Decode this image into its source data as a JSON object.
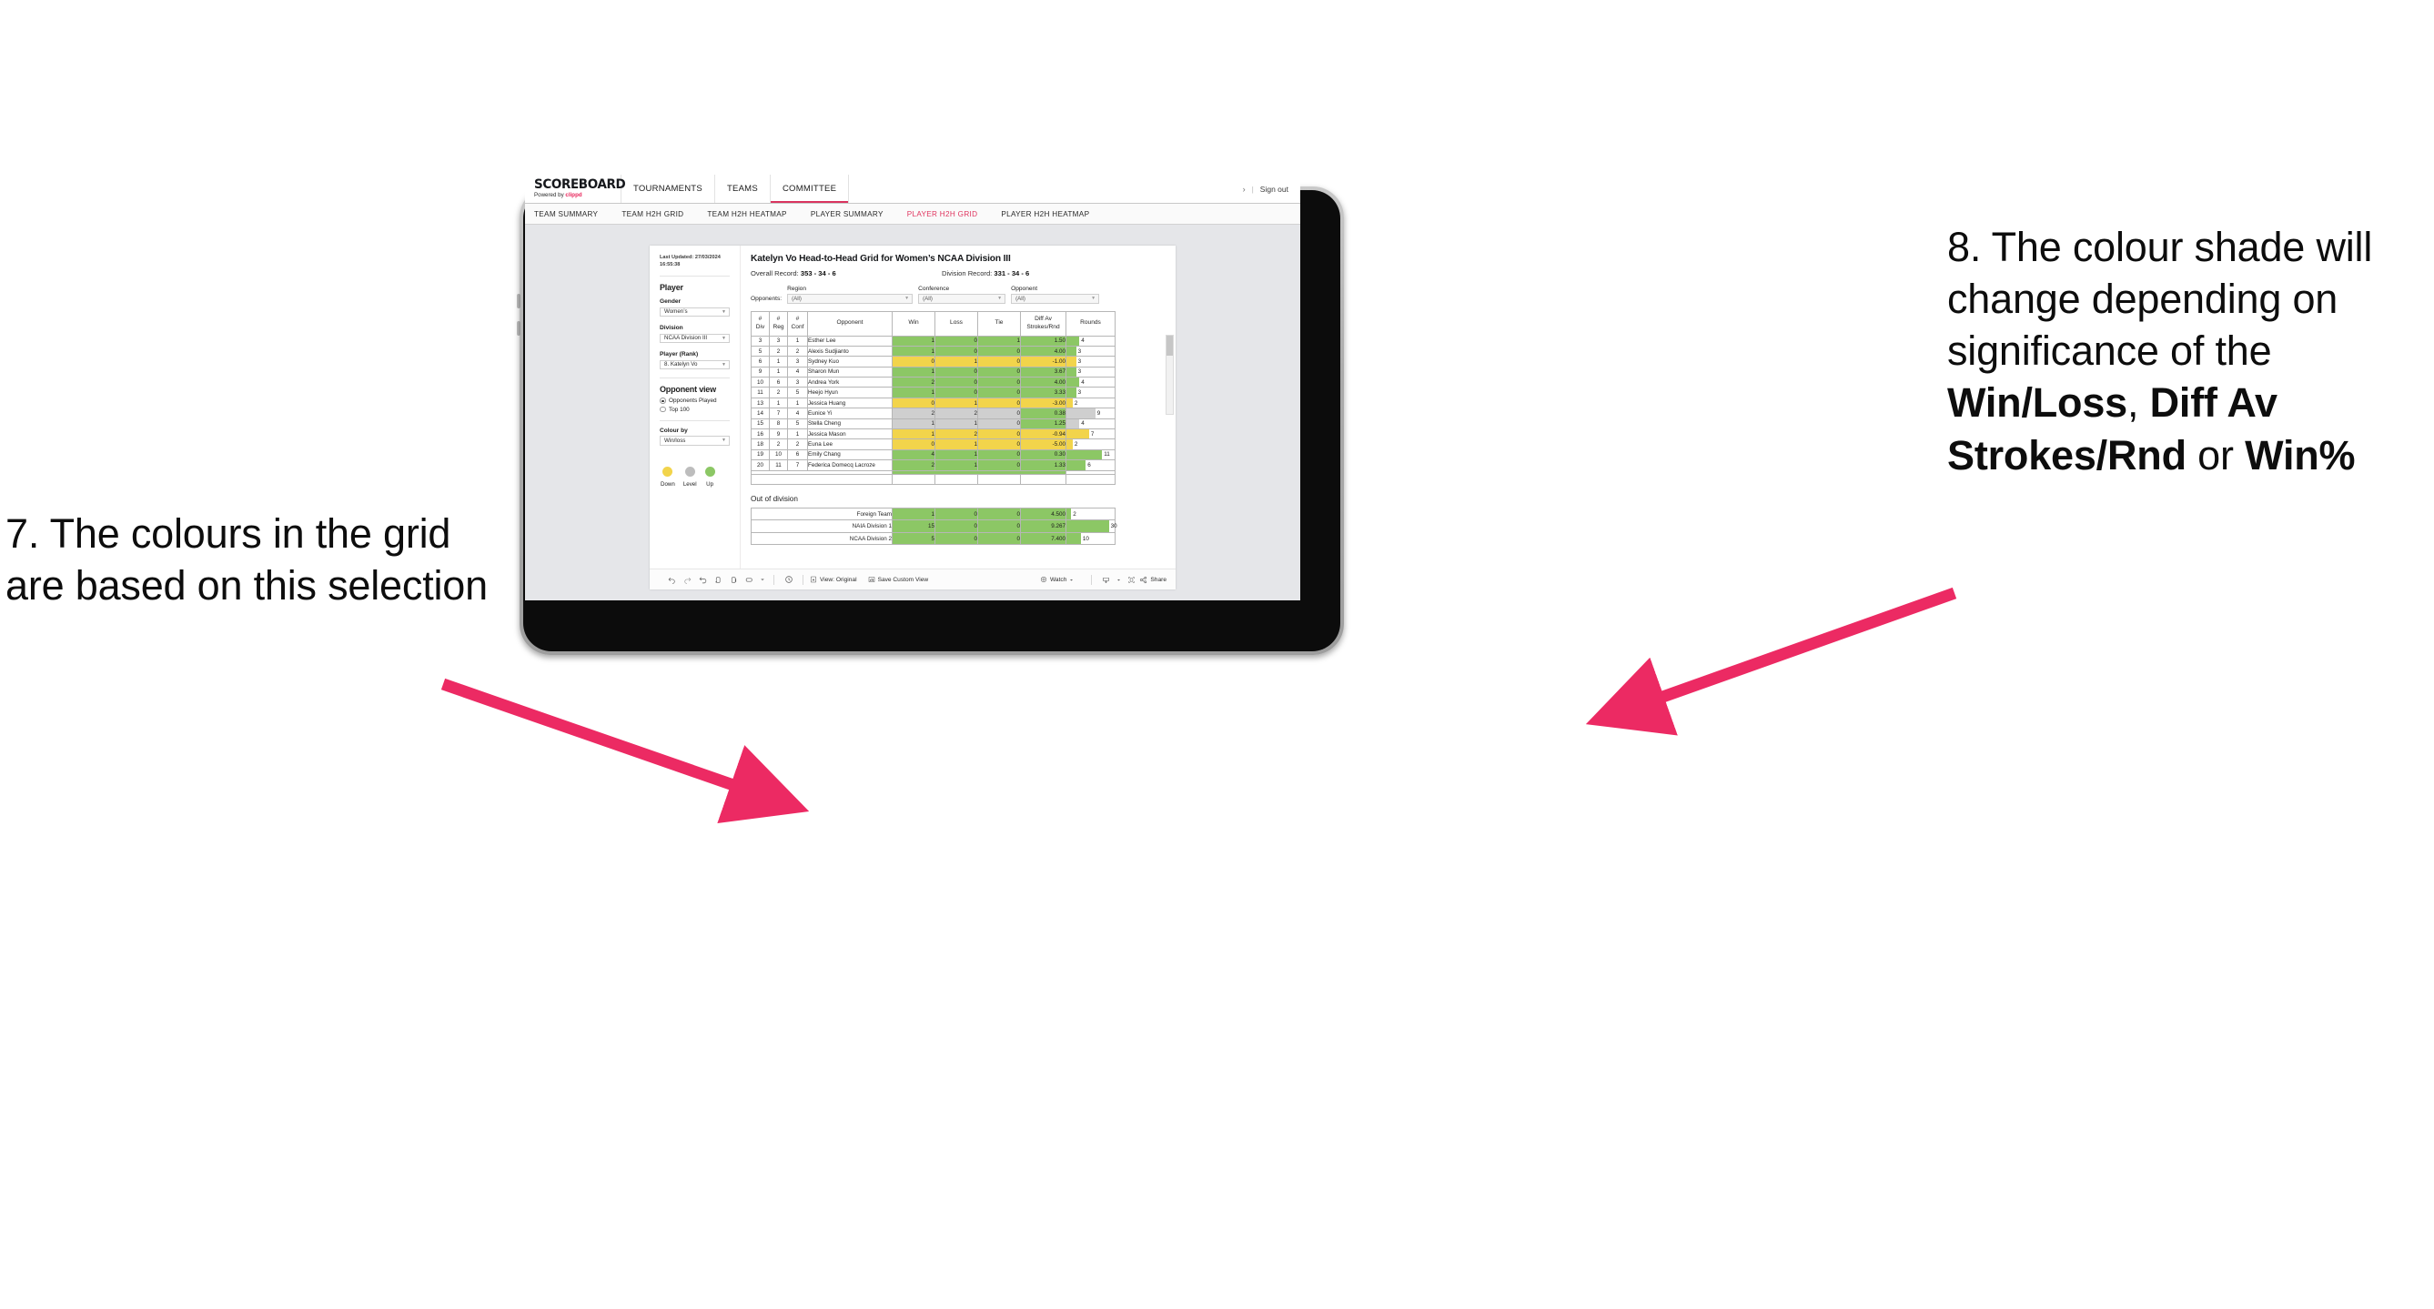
{
  "annotations": {
    "left": {
      "id": "7.",
      "text": "7. The colours in the grid are based on this selection"
    },
    "right": {
      "id": "8.",
      "lead": "8. The colour shade will change depending on significance of the ",
      "bold1": "Win/Loss",
      "mid1": ", ",
      "bold2": "Diff Av Strokes/Rnd",
      "mid2": " or ",
      "bold3": "Win%"
    },
    "arrow_color": "#ec2a63"
  },
  "app": {
    "brand": {
      "name": "SCOREBOARD",
      "powered_prefix": "Powered by ",
      "powered_brand": "clippd"
    },
    "topnav": [
      {
        "label": "TOURNAMENTS",
        "active": false
      },
      {
        "label": "TEAMS",
        "active": false
      },
      {
        "label": "COMMITTEE",
        "active": true
      }
    ],
    "top_right": {
      "chevron": "›",
      "divider": "|",
      "sign_out": "Sign out"
    },
    "subnav": [
      {
        "label": "TEAM SUMMARY",
        "active": false
      },
      {
        "label": "TEAM H2H GRID",
        "active": false
      },
      {
        "label": "TEAM H2H HEATMAP",
        "active": false
      },
      {
        "label": "PLAYER SUMMARY",
        "active": false
      },
      {
        "label": "PLAYER H2H GRID",
        "active": true
      },
      {
        "label": "PLAYER H2H HEATMAP",
        "active": false
      }
    ]
  },
  "sidebar": {
    "last_updated": "Last Updated: 27/03/2024 16:55:38",
    "player_heading": "Player",
    "gender_label": "Gender",
    "gender_value": "Women’s",
    "division_label": "Division",
    "division_value": "NCAA Division III",
    "player_rank_label": "Player (Rank)",
    "player_rank_value": "8. Katelyn Vo",
    "opponent_view_heading": "Opponent view",
    "opponent_view_options": [
      {
        "label": "Opponents Played",
        "selected": true
      },
      {
        "label": "Top 100",
        "selected": false
      }
    ],
    "colour_by_label": "Colour by",
    "colour_by_value": "Win/loss",
    "legend": [
      {
        "label": "Down",
        "color": "#f2d44b"
      },
      {
        "label": "Level",
        "color": "#bdbdbd"
      },
      {
        "label": "Up",
        "color": "#8cc765"
      }
    ]
  },
  "main": {
    "title": "Katelyn Vo Head-to-Head Grid for Women’s NCAA Division III",
    "overall_record_label": "Overall Record: ",
    "overall_record_value": "353 - 34 - 6",
    "division_record_label": "Division Record: ",
    "division_record_value": "331 - 34 - 6",
    "opponents_label": "Opponents:",
    "filters": [
      {
        "title": "Region",
        "value": "(All)"
      },
      {
        "title": "Conference",
        "value": "(All)"
      },
      {
        "title": "Opponent",
        "value": "(All)"
      }
    ],
    "columns": [
      {
        "line1": "#",
        "line2": "Div"
      },
      {
        "line1": "#",
        "line2": "Reg"
      },
      {
        "line1": "#",
        "line2": "Conf"
      },
      {
        "line1": "Opponent",
        "line2": ""
      },
      {
        "line1": "Win",
        "line2": ""
      },
      {
        "line1": "Loss",
        "line2": ""
      },
      {
        "line1": "Tie",
        "line2": ""
      },
      {
        "line1": "Diff Av",
        "line2": "Strokes/Rnd"
      },
      {
        "line1": "Rounds",
        "line2": ""
      }
    ],
    "out_of_division_title": "Out of division"
  },
  "chart_data": {
    "type": "table",
    "title": "Katelyn Vo Head-to-Head Grid for Women’s NCAA Division III",
    "colour_by": "Win/loss",
    "colors": {
      "up": "#8cc765",
      "down": "#f2d44b",
      "level": "#cfcfcf",
      "none": "#ffffff"
    },
    "columns": [
      "# Div",
      "# Reg",
      "# Conf",
      "Opponent",
      "Win",
      "Loss",
      "Tie",
      "Diff Av Strokes/Rnd",
      "Rounds"
    ],
    "rows": [
      {
        "div": "3",
        "reg": "3",
        "conf": "1",
        "opponent": "Esther Lee",
        "win": "1",
        "loss": "0",
        "tie": "1",
        "diff": "1.50",
        "rounds": "4",
        "state": "up",
        "diff_state": "up",
        "bar_pct": 27
      },
      {
        "div": "5",
        "reg": "2",
        "conf": "2",
        "opponent": "Alexis Sudjianto",
        "win": "1",
        "loss": "0",
        "tie": "0",
        "diff": "4.00",
        "rounds": "3",
        "state": "up",
        "diff_state": "up",
        "bar_pct": 20
      },
      {
        "div": "6",
        "reg": "1",
        "conf": "3",
        "opponent": "Sydney Kuo",
        "win": "0",
        "loss": "1",
        "tie": "0",
        "diff": "-1.00",
        "rounds": "3",
        "state": "down",
        "diff_state": "down",
        "bar_pct": 20
      },
      {
        "div": "9",
        "reg": "1",
        "conf": "4",
        "opponent": "Sharon Mun",
        "win": "1",
        "loss": "0",
        "tie": "0",
        "diff": "3.67",
        "rounds": "3",
        "state": "up",
        "diff_state": "up",
        "bar_pct": 20
      },
      {
        "div": "10",
        "reg": "6",
        "conf": "3",
        "opponent": "Andrea York",
        "win": "2",
        "loss": "0",
        "tie": "0",
        "diff": "4.00",
        "rounds": "4",
        "state": "up",
        "diff_state": "up",
        "bar_pct": 27
      },
      {
        "div": "11",
        "reg": "2",
        "conf": "5",
        "opponent": "Heejo Hyun",
        "win": "1",
        "loss": "0",
        "tie": "0",
        "diff": "3.33",
        "rounds": "3",
        "state": "up",
        "diff_state": "up",
        "bar_pct": 20
      },
      {
        "div": "13",
        "reg": "1",
        "conf": "1",
        "opponent": "Jessica Huang",
        "win": "0",
        "loss": "1",
        "tie": "0",
        "diff": "-3.00",
        "rounds": "2",
        "state": "down",
        "diff_state": "down",
        "bar_pct": 13
      },
      {
        "div": "14",
        "reg": "7",
        "conf": "4",
        "opponent": "Eunice Yi",
        "win": "2",
        "loss": "2",
        "tie": "0",
        "diff": "0.38",
        "rounds": "9",
        "state": "level",
        "diff_state": "up",
        "bar_pct": 60
      },
      {
        "div": "15",
        "reg": "8",
        "conf": "5",
        "opponent": "Stella Cheng",
        "win": "1",
        "loss": "1",
        "tie": "0",
        "diff": "1.25",
        "rounds": "4",
        "state": "level",
        "diff_state": "up",
        "bar_pct": 27
      },
      {
        "div": "16",
        "reg": "9",
        "conf": "1",
        "opponent": "Jessica Mason",
        "win": "1",
        "loss": "2",
        "tie": "0",
        "diff": "-0.94",
        "rounds": "7",
        "state": "down",
        "diff_state": "down",
        "bar_pct": 47
      },
      {
        "div": "18",
        "reg": "2",
        "conf": "2",
        "opponent": "Euna Lee",
        "win": "0",
        "loss": "1",
        "tie": "0",
        "diff": "-5.00",
        "rounds": "2",
        "state": "down",
        "diff_state": "down",
        "bar_pct": 13
      },
      {
        "div": "19",
        "reg": "10",
        "conf": "6",
        "opponent": "Emily Chang",
        "win": "4",
        "loss": "1",
        "tie": "0",
        "diff": "0.30",
        "rounds": "11",
        "state": "up",
        "diff_state": "up",
        "bar_pct": 74
      },
      {
        "div": "20",
        "reg": "11",
        "conf": "7",
        "opponent": "Federica Domecq Lacroze",
        "win": "2",
        "loss": "1",
        "tie": "0",
        "diff": "1.33",
        "rounds": "6",
        "state": "up",
        "diff_state": "up",
        "bar_pct": 40
      }
    ],
    "out_of_division": [
      {
        "name": "Foreign Team",
        "win": "1",
        "loss": "0",
        "tie": "0",
        "diff": "4.500",
        "rounds": "2",
        "state": "up",
        "bar_pct": 10
      },
      {
        "name": "NAIA Division 1",
        "win": "15",
        "loss": "0",
        "tie": "0",
        "diff": "9.267",
        "rounds": "30",
        "state": "up",
        "bar_pct": 88
      },
      {
        "name": "NCAA Division 2",
        "win": "5",
        "loss": "0",
        "tie": "0",
        "diff": "7.400",
        "rounds": "10",
        "state": "up",
        "bar_pct": 30
      }
    ]
  },
  "toolbar": {
    "icons": [
      "undo-icon",
      "redo-icon",
      "revert-icon",
      "refresh-data-icon",
      "pause-updates-icon",
      "device-layout-icon",
      "device-layout-caret-icon"
    ],
    "alerts_icon": "alerts-icon",
    "view_original": "View: Original",
    "save_custom_view": "Save Custom View",
    "watch": "Watch",
    "download_icon": "download-icon",
    "fullscreen_icon": "fullscreen-icon",
    "share": "Share"
  }
}
